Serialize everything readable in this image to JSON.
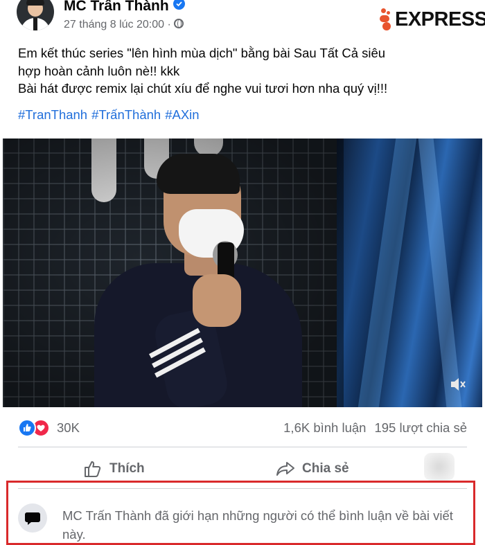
{
  "post": {
    "author": "MC Trấn Thành",
    "timestamp": "27 tháng 8 lúc 20:00 ·",
    "text_lines": [
      "Em kết thúc series \"lên hình mùa dịch\" bằng bài Sau Tất Cả siêu",
      "hợp hoàn cảnh luôn nè!! kkk",
      "Bài hát được remix lại chút xíu để nghe vui tươi hơn nha quý vị!!!"
    ],
    "hashtags": [
      "#TranThanh",
      "#TrấnThành",
      "#AXin"
    ]
  },
  "watermark": {
    "text": "EXPRESS",
    "accent": "#e8542e"
  },
  "reactions": {
    "count": "30K",
    "comments": "1,6K bình luận",
    "shares": "195 lượt chia sẻ"
  },
  "actions": {
    "like": "Thích",
    "share": "Chia sẻ"
  },
  "notice": {
    "text": "MC Trấn Thành đã giới hạn những người có thể bình luận về bài viết này."
  },
  "icons": [
    "verified-icon",
    "globe-icon",
    "mute-icon",
    "like-icon",
    "share-icon",
    "comment-restricted-icon"
  ],
  "colors": {
    "link": "#216fdb",
    "like": "#1877f2",
    "love": "#f0284a",
    "highlight": "#d9292b"
  }
}
